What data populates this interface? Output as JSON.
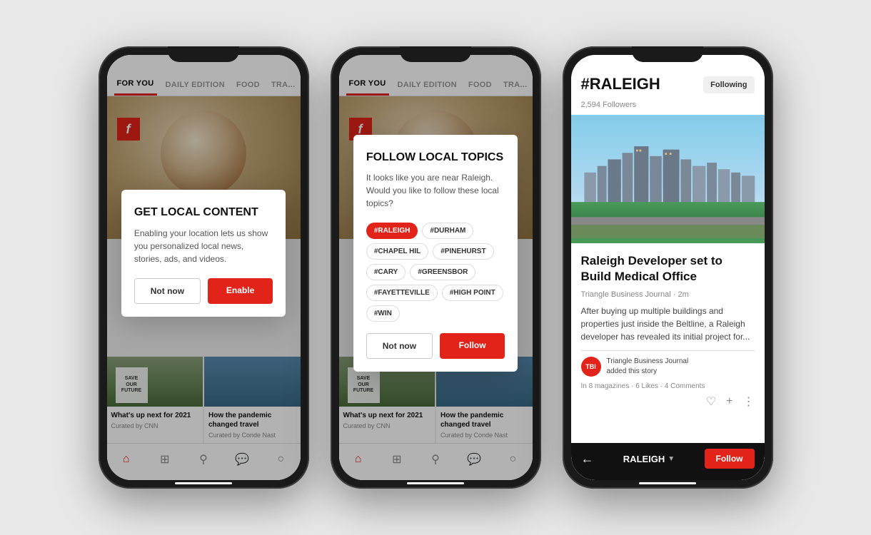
{
  "page": {
    "background": "#e8e8e8"
  },
  "phone1": {
    "nav": {
      "items": [
        {
          "label": "FOR YOU",
          "active": true
        },
        {
          "label": "DAILY EDITION",
          "active": false
        },
        {
          "label": "FOOD",
          "active": false
        },
        {
          "label": "TRA...",
          "active": false
        }
      ]
    },
    "modal": {
      "title": "GET LOCAL CONTENT",
      "description": "Enabling your location lets us show you personalized local news, stories, ads, and videos.",
      "btn_not_now": "Not now",
      "btn_enable": "Enable"
    },
    "stories": [
      {
        "title": "What's up next for 2021",
        "source": "Curated by CNN"
      },
      {
        "title": "How the pandemic changed travel",
        "source": "Curated by Conde Nast"
      }
    ]
  },
  "phone2": {
    "nav": {
      "items": [
        {
          "label": "FOR YOU",
          "active": true
        },
        {
          "label": "DAILY EDITION",
          "active": false
        },
        {
          "label": "FOOD",
          "active": false
        },
        {
          "label": "TRA...",
          "active": false
        }
      ]
    },
    "modal": {
      "title": "FOLLOW LOCAL TOPICS",
      "description": "It looks like you are near Raleigh. Would you like to follow these local topics?",
      "btn_not_now": "Not now",
      "btn_follow": "Follow",
      "tags": [
        {
          "label": "#RALEIGH",
          "active": true
        },
        {
          "label": "#DURHAM",
          "active": false
        },
        {
          "label": "#CHAPEL HIL",
          "active": false
        },
        {
          "label": "#PINEHURST",
          "active": false
        },
        {
          "label": "#CARY",
          "active": false
        },
        {
          "label": "#GREENSBOR",
          "active": false
        },
        {
          "label": "#FAYETTEVILLE",
          "active": false
        },
        {
          "label": "#HIGH POINT",
          "active": false
        },
        {
          "label": "#WIN",
          "active": false
        }
      ]
    },
    "stories": [
      {
        "title": "What's up next for 2021",
        "source": "Curated by CNN"
      },
      {
        "title": "How the pandemic changed travel",
        "source": "Curated by Conde Nast"
      }
    ]
  },
  "phone3": {
    "hashtag": "#RALEIGH",
    "following_label": "Following",
    "followers": "2,594 Followers",
    "article": {
      "headline": "Raleigh Developer set to Build Medical Office",
      "source": "Triangle Business Journal",
      "time": "2m",
      "excerpt": "After buying up multiple buildings and properties just inside the Beltline, a Raleigh developer has revealed its initial project for...",
      "byline_name": "Triangle Business Journal",
      "byline_action": "added this story",
      "stats": "In 8 magazines · 6 Likes · 4 Comments"
    },
    "bottom_nav": {
      "title": "RALEIGH",
      "follow_label": "Follow",
      "back": "←"
    }
  }
}
